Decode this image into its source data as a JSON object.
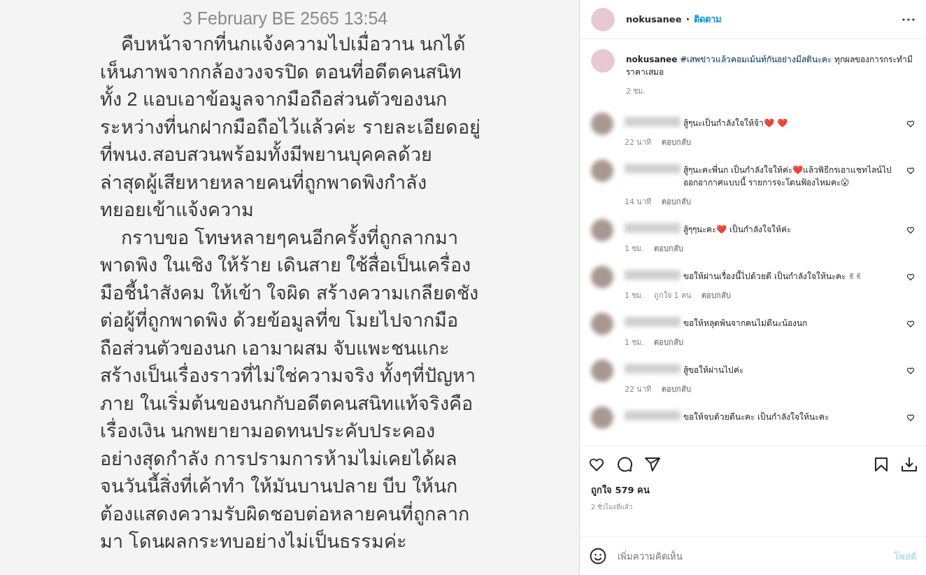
{
  "post_image": {
    "date": "3 February BE 2565 13:54",
    "paragraphs": [
      [
        "คืบหน้าจากที่นกแจ้งความไปเมื่อวาน นกได้",
        "เห็นภาพจากกล้องวงจรปิด ตอนที่อดีตคนสนิท",
        "ทั้ง 2 แอบเอาข้อมูลจากมือถือส่วนตัวของนก",
        "ระหว่างที่นกฝากมือถือไว้แล้วค่ะ รายละเอียดอยู่",
        "ที่พนง.สอบสวนพร้อมทั้งมีพยานบุคคลด้วย",
        "ล่าสุดผู้เสียหายหลายคนที่ถูกพาดพิงกำลัง",
        "ทยอยเข้าแจ้งความ"
      ],
      [
        "กราบขอ โทษหลายๆคนอีกครั้งที่ถูกลากมา",
        "พาดพิง ในเชิง ให้ร้าย เดินสาย ใช้สื่อเป็นเครื่อง",
        "มือชี้นำสังคม ให้เข้า ใจผิด สร้างความเกลียดชัง",
        "ต่อผู้ที่ถูกพาดพิง ด้วยข้อมูลที่ข โมยไปจากมือ",
        "ถือส่วนตัวของนก เอามาผสม จับแพะชนแกะ",
        "สร้างเป็นเรื่องราวที่ไม่ใช่ความจริง ทั้งๆที่ปัญหา",
        "ภาย ในเริ่มต้นของนกกับอดีตคนสนิทแท้จริงคือ",
        "เรื่องเงิน นกพยายามอดทนประคับประคอง",
        "อย่างสุดกำลัง การปรามการห้ามไม่เคยได้ผล",
        "จนวันนี้สิ่งที่เค้าทำ ให้มันบานปลาย บีบ ให้นก",
        "ต้องแสดงความรับผิดชอบต่อหลายคนที่ถูกลาก",
        "มา โดนผลกระทบอย่างไม่เป็นธรรมค่ะ"
      ]
    ]
  },
  "header": {
    "username": "nokusanee",
    "separator": "•",
    "follow": "ติดตาม"
  },
  "caption": {
    "username": "nokusanee",
    "hashtag": "#เสพข่าวแล้วคอมเม้นท์กันอย่างมีสตินะคะ",
    "text": "ทุกผลของการกระทำมีราคาเสมอ",
    "time": "2 ชม."
  },
  "comments": [
    {
      "text": "สู้ๆนะเป็นกำลังใจให้จ้า❤️ ❤️",
      "time": "22 นาที",
      "reply": "ตอบกลับ"
    },
    {
      "text": "สู้ๆนะคะพี่นก เป็นกำลังใจให้ค่ะ❤️แล้วพิธีกรเอาแชทไลน์ไปออกอากาศแบบนี้ รายการจะโดนฟ้องไหมคะ😮",
      "time": "14 นาที",
      "reply": "ตอบกลับ"
    },
    {
      "text": "สู้ๆๆนะคะ❤️ เป็นกำลังใจให้ค่ะ",
      "time": "1 ชม.",
      "reply": "ตอบกลับ"
    },
    {
      "text": "ขอให้ผ่านเรื่องนี้ไปด้วยดี เป็นกำลังใจให้นะคะ ✌✌",
      "time": "1 ชม.",
      "likes": "ถูกใจ 1 คน",
      "reply": "ตอบกลับ"
    },
    {
      "text": "ขอให้หลุดพ้นจากคนไม่ดีนะน้องนก",
      "time": "1 ชม.",
      "reply": "ตอบกลับ"
    },
    {
      "text": "สู้ขอให้ผ่านไปค่ะ",
      "time": "22 นาที",
      "reply": "ตอบกลับ"
    },
    {
      "text": "ขอให้จบด้วยดีนะคะ เป็นกำลังใจให้นะคะ"
    }
  ],
  "likes": "ถูกใจ 579 คน",
  "posted": "2 ชั่วโมงที่แล้ว",
  "comment_box": {
    "placeholder": "เพิ่มความคิดเห็น",
    "post_button": "โพสต์",
    "disabled": true
  }
}
